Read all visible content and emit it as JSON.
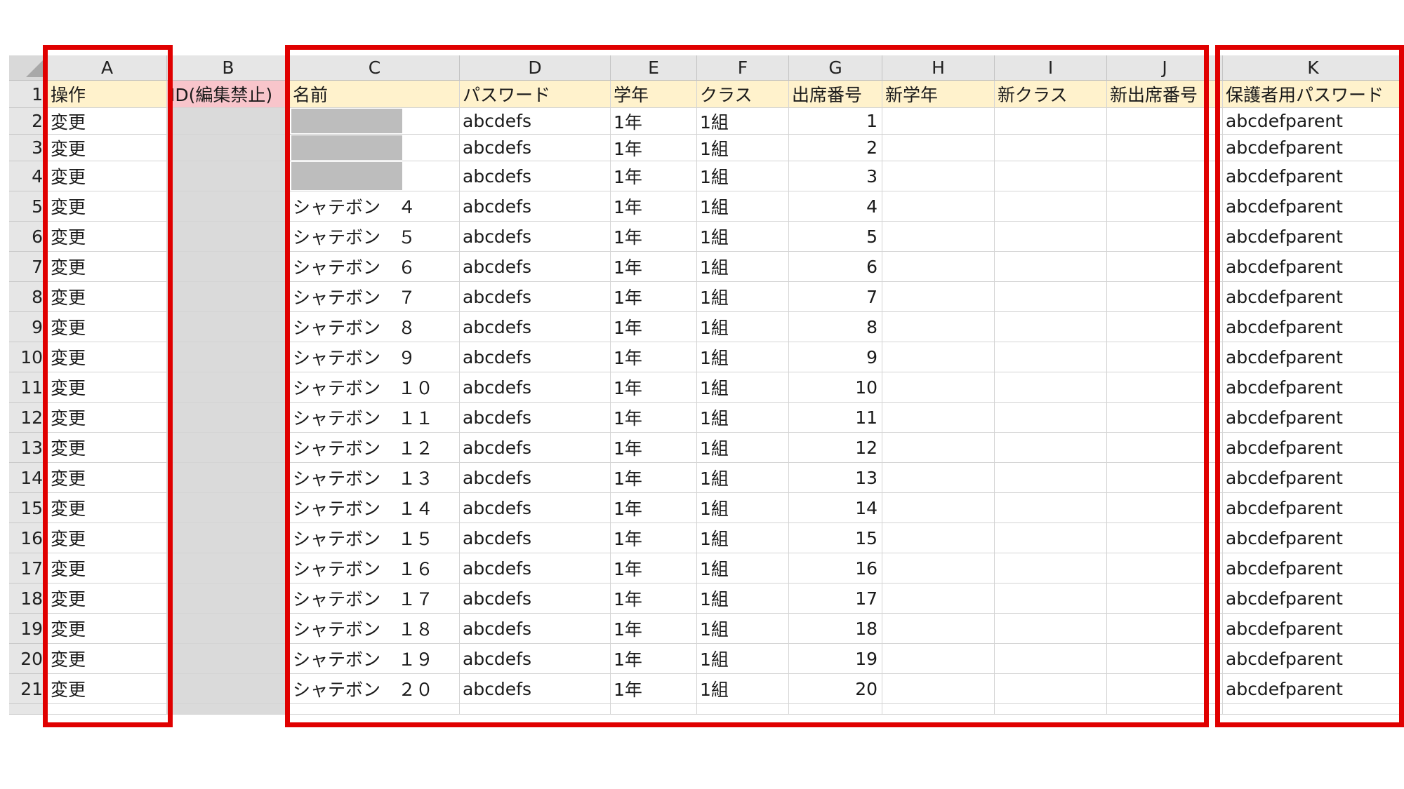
{
  "columns": [
    {
      "letter": "A",
      "header": "操作",
      "style": "hdr"
    },
    {
      "letter": "B",
      "header": "ID(編集禁止)",
      "style": "hdr-pink"
    },
    {
      "letter": "C",
      "header": "名前",
      "style": "hdr"
    },
    {
      "letter": "D",
      "header": "パスワード",
      "style": "hdr"
    },
    {
      "letter": "E",
      "header": "学年",
      "style": "hdr"
    },
    {
      "letter": "F",
      "header": "クラス",
      "style": "hdr"
    },
    {
      "letter": "G",
      "header": "出席番号",
      "style": "hdr"
    },
    {
      "letter": "H",
      "header": "新学年",
      "style": "hdr"
    },
    {
      "letter": "I",
      "header": "新クラス",
      "style": "hdr"
    },
    {
      "letter": "J",
      "header": "新出席番号",
      "style": "hdr"
    },
    {
      "letter": "K",
      "header": "保護者用パスワード",
      "style": "hdr"
    }
  ],
  "rows": [
    {
      "num": "2",
      "op": "変更",
      "id": "",
      "name": "",
      "name_redacted": true,
      "password": "abcdefs",
      "grade": "1年",
      "class": "1組",
      "attendance": "1",
      "new_grade": "",
      "new_class": "",
      "new_attendance": "",
      "parent_password": "abcdefparent"
    },
    {
      "num": "3",
      "op": "変更",
      "id": "",
      "name": "",
      "name_redacted": true,
      "password": "abcdefs",
      "grade": "1年",
      "class": "1組",
      "attendance": "2",
      "new_grade": "",
      "new_class": "",
      "new_attendance": "",
      "parent_password": "abcdefparent"
    },
    {
      "num": "4",
      "op": "変更",
      "id": "",
      "name": "",
      "name_redacted": true,
      "password": "abcdefs",
      "grade": "1年",
      "class": "1組",
      "attendance": "3",
      "new_grade": "",
      "new_class": "",
      "new_attendance": "",
      "parent_password": "abcdefparent"
    },
    {
      "num": "5",
      "op": "変更",
      "id": "",
      "name": "シャテボン　４",
      "name_redacted": false,
      "password": "abcdefs",
      "grade": "1年",
      "class": "1組",
      "attendance": "4",
      "new_grade": "",
      "new_class": "",
      "new_attendance": "",
      "parent_password": "abcdefparent"
    },
    {
      "num": "6",
      "op": "変更",
      "id": "",
      "name": "シャテボン　５",
      "name_redacted": false,
      "password": "abcdefs",
      "grade": "1年",
      "class": "1組",
      "attendance": "5",
      "new_grade": "",
      "new_class": "",
      "new_attendance": "",
      "parent_password": "abcdefparent"
    },
    {
      "num": "7",
      "op": "変更",
      "id": "",
      "name": "シャテボン　６",
      "name_redacted": false,
      "password": "abcdefs",
      "grade": "1年",
      "class": "1組",
      "attendance": "6",
      "new_grade": "",
      "new_class": "",
      "new_attendance": "",
      "parent_password": "abcdefparent"
    },
    {
      "num": "8",
      "op": "変更",
      "id": "",
      "name": "シャテボン　７",
      "name_redacted": false,
      "password": "abcdefs",
      "grade": "1年",
      "class": "1組",
      "attendance": "7",
      "new_grade": "",
      "new_class": "",
      "new_attendance": "",
      "parent_password": "abcdefparent"
    },
    {
      "num": "9",
      "op": "変更",
      "id": "",
      "name": "シャテボン　８",
      "name_redacted": false,
      "password": "abcdefs",
      "grade": "1年",
      "class": "1組",
      "attendance": "8",
      "new_grade": "",
      "new_class": "",
      "new_attendance": "",
      "parent_password": "abcdefparent"
    },
    {
      "num": "10",
      "op": "変更",
      "id": "",
      "name": "シャテボン　９",
      "name_redacted": false,
      "password": "abcdefs",
      "grade": "1年",
      "class": "1組",
      "attendance": "9",
      "new_grade": "",
      "new_class": "",
      "new_attendance": "",
      "parent_password": "abcdefparent"
    },
    {
      "num": "11",
      "op": "変更",
      "id": "",
      "name": "シャテボン　１０",
      "name_redacted": false,
      "password": "abcdefs",
      "grade": "1年",
      "class": "1組",
      "attendance": "10",
      "new_grade": "",
      "new_class": "",
      "new_attendance": "",
      "parent_password": "abcdefparent"
    },
    {
      "num": "12",
      "op": "変更",
      "id": "",
      "name": "シャテボン　１１",
      "name_redacted": false,
      "password": "abcdefs",
      "grade": "1年",
      "class": "1組",
      "attendance": "11",
      "new_grade": "",
      "new_class": "",
      "new_attendance": "",
      "parent_password": "abcdefparent"
    },
    {
      "num": "13",
      "op": "変更",
      "id": "",
      "name": "シャテボン　１２",
      "name_redacted": false,
      "password": "abcdefs",
      "grade": "1年",
      "class": "1組",
      "attendance": "12",
      "new_grade": "",
      "new_class": "",
      "new_attendance": "",
      "parent_password": "abcdefparent"
    },
    {
      "num": "14",
      "op": "変更",
      "id": "",
      "name": "シャテボン　１３",
      "name_redacted": false,
      "password": "abcdefs",
      "grade": "1年",
      "class": "1組",
      "attendance": "13",
      "new_grade": "",
      "new_class": "",
      "new_attendance": "",
      "parent_password": "abcdefparent"
    },
    {
      "num": "15",
      "op": "変更",
      "id": "",
      "name": "シャテボン　１４",
      "name_redacted": false,
      "password": "abcdefs",
      "grade": "1年",
      "class": "1組",
      "attendance": "14",
      "new_grade": "",
      "new_class": "",
      "new_attendance": "",
      "parent_password": "abcdefparent"
    },
    {
      "num": "16",
      "op": "変更",
      "id": "",
      "name": "シャテボン　１５",
      "name_redacted": false,
      "password": "abcdefs",
      "grade": "1年",
      "class": "1組",
      "attendance": "15",
      "new_grade": "",
      "new_class": "",
      "new_attendance": "",
      "parent_password": "abcdefparent"
    },
    {
      "num": "17",
      "op": "変更",
      "id": "",
      "name": "シャテボン　１６",
      "name_redacted": false,
      "password": "abcdefs",
      "grade": "1年",
      "class": "1組",
      "attendance": "16",
      "new_grade": "",
      "new_class": "",
      "new_attendance": "",
      "parent_password": "abcdefparent"
    },
    {
      "num": "18",
      "op": "変更",
      "id": "",
      "name": "シャテボン　１７",
      "name_redacted": false,
      "password": "abcdefs",
      "grade": "1年",
      "class": "1組",
      "attendance": "17",
      "new_grade": "",
      "new_class": "",
      "new_attendance": "",
      "parent_password": "abcdefparent"
    },
    {
      "num": "19",
      "op": "変更",
      "id": "",
      "name": "シャテボン　１８",
      "name_redacted": false,
      "password": "abcdefs",
      "grade": "1年",
      "class": "1組",
      "attendance": "18",
      "new_grade": "",
      "new_class": "",
      "new_attendance": "",
      "parent_password": "abcdefparent"
    },
    {
      "num": "20",
      "op": "変更",
      "id": "",
      "name": "シャテボン　１９",
      "name_redacted": false,
      "password": "abcdefs",
      "grade": "1年",
      "class": "1組",
      "attendance": "19",
      "new_grade": "",
      "new_class": "",
      "new_attendance": "",
      "parent_password": "abcdefparent"
    },
    {
      "num": "21",
      "op": "変更",
      "id": "",
      "name": "シャテボン　２０",
      "name_redacted": false,
      "password": "abcdefs",
      "grade": "1年",
      "class": "1組",
      "attendance": "20",
      "new_grade": "",
      "new_class": "",
      "new_attendance": "",
      "parent_password": "abcdefparent"
    }
  ],
  "header_row_num": "1",
  "highlight_color": "#e00000",
  "grey_column": "B"
}
